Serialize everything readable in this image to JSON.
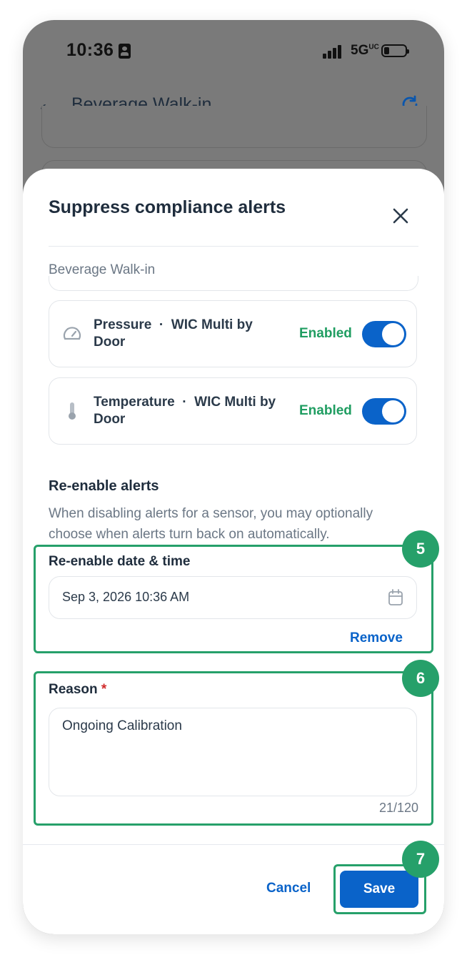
{
  "status_bar": {
    "time": "10:36",
    "network": "5G",
    "network_sup": "UC"
  },
  "app_bar": {
    "title": "Beverage Walk-in"
  },
  "sheet": {
    "title": "Suppress compliance alerts",
    "location": "Beverage Walk-in",
    "sensors": [
      {
        "type": "Pressure",
        "separator": "·",
        "device": "WIC Multi by Door",
        "state": "Enabled",
        "icon": "gauge-icon",
        "enabled": true
      },
      {
        "type": "Temperature",
        "separator": "·",
        "device": "WIC Multi by Door",
        "state": "Enabled",
        "icon": "thermometer-icon",
        "enabled": true
      }
    ],
    "reenable": {
      "title": "Re-enable alerts",
      "description": "When disabling alerts for a sensor, you may optionally choose when alerts turn back on automatically.",
      "field_label": "Re-enable date & time",
      "value": "Sep 3, 2026 10:36 AM",
      "remove_label": "Remove"
    },
    "reason": {
      "label": "Reason",
      "required_mark": "*",
      "value": "Ongoing Calibration",
      "counter": "21/120"
    },
    "footer": {
      "cancel_label": "Cancel",
      "save_label": "Save"
    }
  },
  "annotations": {
    "step_5": "5",
    "step_6": "6",
    "step_7": "7",
    "highlight_color": "#26a06a"
  },
  "colors": {
    "primary": "#0a63c9",
    "enabled_text": "#1f9d61",
    "required": "#d02a2a"
  }
}
